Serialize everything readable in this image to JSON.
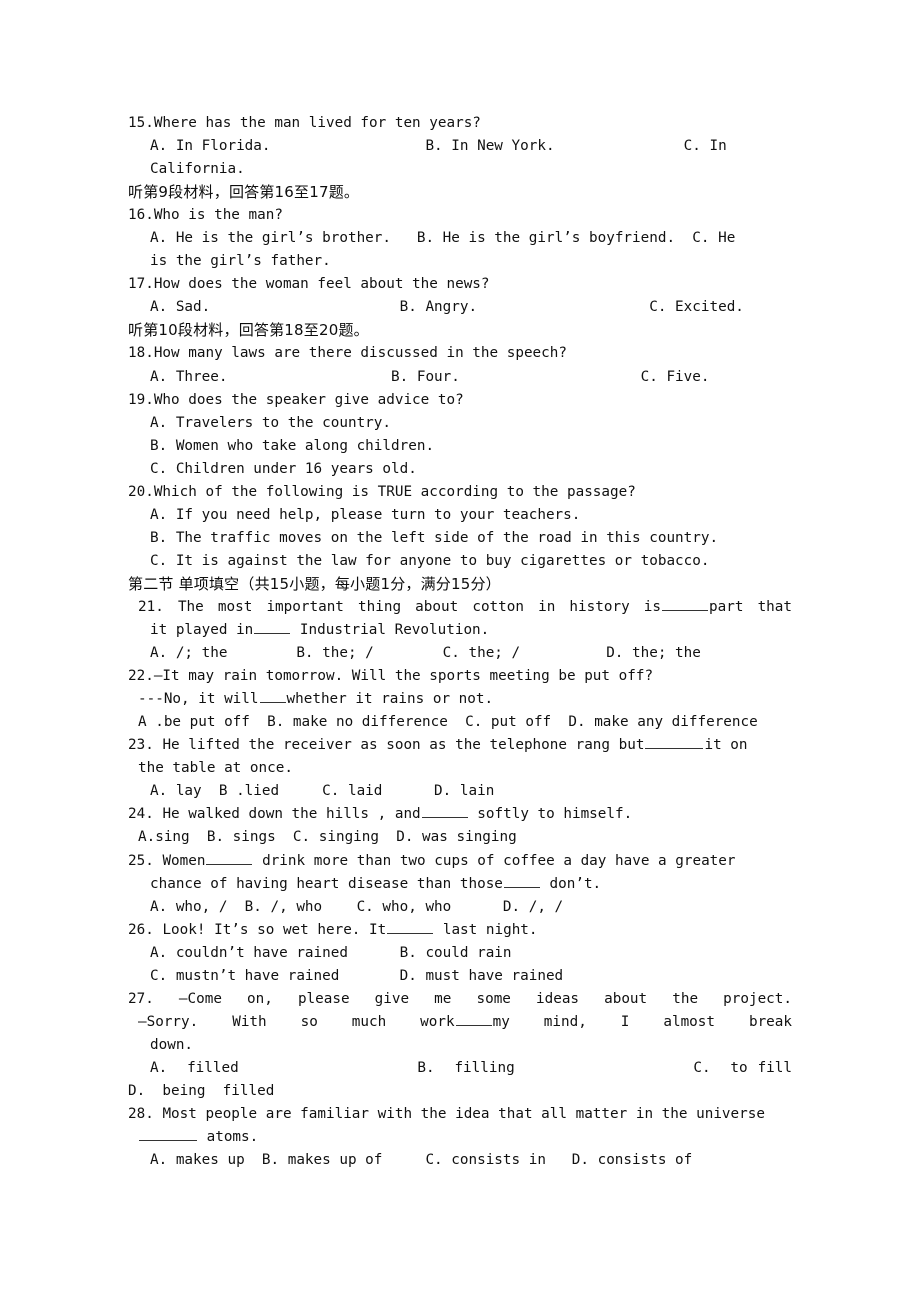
{
  "document": {
    "type": "english-exam-paper",
    "language_mix": [
      "en",
      "zh-CN"
    ]
  },
  "listening_section": {
    "questions": [
      {
        "number": "15.",
        "stem": "Where has the man lived for ten years?",
        "options_line": "A. In Florida.                  B. In New York.               C. In California."
      },
      {
        "number": "16.",
        "stem": "Who is the man?",
        "option_a": "A. He is the girl’s brother.",
        "option_b": "B. He is the girl’s boyfriend.",
        "option_c_part1": "C. He",
        "option_c_part2": "is the girl’s father."
      },
      {
        "number": "17.",
        "stem": "How does the woman feel about the news?",
        "options_line": "A. Sad.                      B. Angry.                    C. Excited."
      },
      {
        "number": "18.",
        "stem": "How many laws are there discussed in the speech?",
        "options_line": "A. Three.                   B. Four.                     C. Five."
      },
      {
        "number": "19.",
        "stem": "Who does the speaker give advice to?",
        "option_a": "A. Travelers to the country.",
        "option_b": "B. Women who take along children.",
        "option_c": "C. Children under 16 years old."
      },
      {
        "number": "20.",
        "stem": "Which of the following is TRUE according to the passage?",
        "option_a": "A. If you need help, please turn to your teachers.",
        "option_b": "B. The traffic moves on the left side of the road in this country.",
        "option_c": "C. It is against the law for anyone to buy cigarettes or tobacco."
      }
    ],
    "direction_line_9": "听第9段材料，回答第16至17题。",
    "direction_line_10": "听第10段材料，回答第18至20题。"
  },
  "section_two": {
    "heading": "第二节 单项填空（共15小题，每小题1分，满分15分）",
    "questions": [
      {
        "number": "21.",
        "stem_line1_a": "The most important thing about cotton in history is",
        "stem_line1_b": "part that",
        "stem_line2_a": "it played in",
        "stem_line2_b": "Industrial Revolution.",
        "options_line": "A. /; the        B. the; /        C. the; /          D. the; the"
      },
      {
        "number": "22.",
        "stem_line1": "—It may rain tomorrow. Will the sports meeting be put off?",
        "stem_line2_a": "---No, it will",
        "stem_line2_b": "whether it rains or not.",
        "options_line": "A .be put off  B. make no difference  C. put off  D. make any difference"
      },
      {
        "number": "23.",
        "stem_line1_a": "He lifted the receiver as soon as the telephone rang but",
        "stem_line1_b": "it on",
        "stem_line2": "the table at once.",
        "options_line": "A. lay  B .lied     C. laid      D. lain"
      },
      {
        "number": "24.",
        "stem_line1_a": "He walked down the hills , and",
        "stem_line1_b": "softly to himself.",
        "options_line": "A.sing  B. sings  C. singing  D. was singing"
      },
      {
        "number": "25.",
        "stem_line1_a": "Women",
        "stem_line1_b": "drink more than two cups of coffee a day have a greater",
        "stem_line2_a": "chance of having heart disease than those",
        "stem_line2_b": "don’t.",
        "options_line": "A. who, /  B. /, who    C. who, who      D. /, /"
      },
      {
        "number": "26.",
        "stem_line1_a": "Look! It’s so wet here. It",
        "stem_line1_b": "last night.",
        "options_line1": "A. couldn’t have rained      B. could rain",
        "options_line2": "C. mustn’t have rained       D. must have rained"
      },
      {
        "number": "27.",
        "stem_line1": "—Come on, please give me some ideas about the project.",
        "stem_line2_a": "—Sorry. With so much work",
        "stem_line2_b": "my mind, I almost break",
        "stem_line3": "down.",
        "options_line1": "A.  filled                  B.  filling                  C.  to fill",
        "options_line2": "D.  being  filled"
      },
      {
        "number": "28.",
        "stem_line1": "Most people are familiar with the idea that all matter in the universe",
        "stem_line2_b": "atoms.",
        "options_line": "A. makes up  B. makes up of     C. consists in   D. consists of"
      }
    ]
  }
}
